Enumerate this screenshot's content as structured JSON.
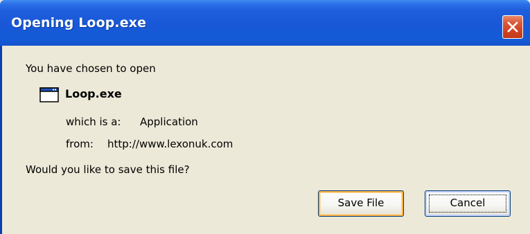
{
  "dialog": {
    "title": "Opening Loop.exe",
    "intro": "You have chosen to open",
    "file": {
      "name": "Loop.exe",
      "icon": "application-window-icon",
      "type_label": "which is a:",
      "type_value": "Application",
      "from_label": "from:",
      "from_value": "http://www.lexonuk.com"
    },
    "question": "Would you like to save this file?",
    "buttons": {
      "save_label": "Save File",
      "cancel_label": "Cancel"
    },
    "close_icon": "close-icon"
  },
  "colors": {
    "titlebar": "#1858d8",
    "client_background": "#ece9d8",
    "close_button": "#d4512f",
    "default_button_highlight": "#f8b347"
  }
}
